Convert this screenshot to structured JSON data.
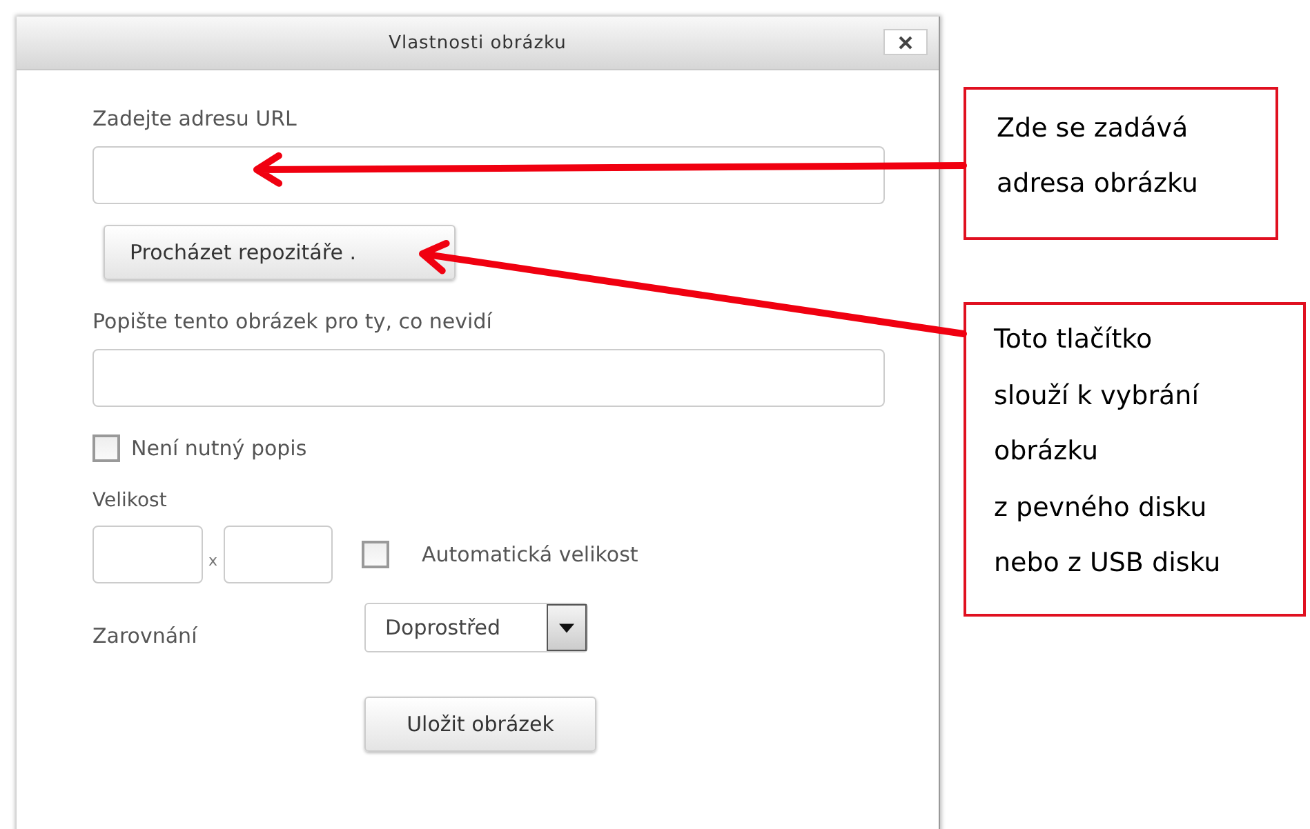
{
  "dialog": {
    "title": "Vlastnosti obrázku",
    "url": {
      "label": "Zadejte adresu URL"
    },
    "browse_button": "Procházet repozitáře .",
    "description": {
      "label": "Popište tento obrázek pro ty, co nevidí"
    },
    "no_description": {
      "label": "Není nutný popis",
      "checked": false
    },
    "size": {
      "label": "Velikost",
      "separator": "x",
      "auto": {
        "label": "Automatická velikost",
        "checked": false
      }
    },
    "alignment": {
      "label": "Zarovnání",
      "value": "Doprostřed"
    },
    "save_button": "Uložit obrázek"
  },
  "callouts": [
    {
      "text": "Zde se zadává\nadresa obrázku"
    },
    {
      "text": "Toto tlačítko\nslouží k vybrání\nobrázku\nz pevného disku\nnebo z USB disku"
    }
  ]
}
